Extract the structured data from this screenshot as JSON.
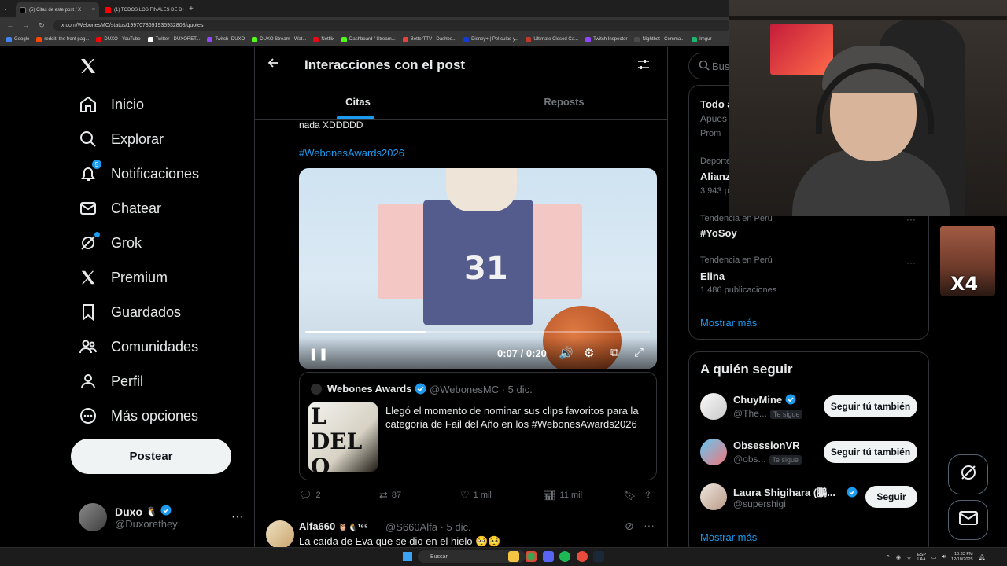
{
  "browser": {
    "tabs": [
      {
        "title": "(5) Citas de este post / X",
        "active": true,
        "color": "#ffffff"
      },
      {
        "title": "(1) TODOS LOS FINALES DE DI",
        "active": false,
        "color": "#ff0000"
      }
    ],
    "url": "x.com/WebonesMC/status/1997078691935932808/quotes",
    "bookmarks": [
      {
        "label": "Google",
        "color": "#4285f4"
      },
      {
        "label": "reddit: the front pag...",
        "color": "#ff4500"
      },
      {
        "label": "DUXO - YouTube",
        "color": "#ff0000"
      },
      {
        "label": "Twitter - DUXORET...",
        "color": "#ffffff"
      },
      {
        "label": "Twitch- DUXO",
        "color": "#9146ff"
      },
      {
        "label": "DUXO Stream - Wat...",
        "color": "#53fc18"
      },
      {
        "label": "Netflix",
        "color": "#e50914"
      },
      {
        "label": "Dashboard / Stream...",
        "color": "#53fc18"
      },
      {
        "label": "BetterTTV - Dashbo...",
        "color": "#e54141"
      },
      {
        "label": "Disney+ | Películas y...",
        "color": "#113ccf"
      },
      {
        "label": "Ultimate Closed Ca...",
        "color": "#c0392b"
      },
      {
        "label": "Twitch Inspector",
        "color": "#9146ff"
      },
      {
        "label": "Nightbot - Comma...",
        "color": "#4c4c4c"
      },
      {
        "label": "Imgur",
        "color": "#1bb76e"
      }
    ]
  },
  "nav": {
    "items": [
      {
        "label": "Inicio",
        "icon": "home-icon"
      },
      {
        "label": "Explorar",
        "icon": "search-icon"
      },
      {
        "label": "Notificaciones",
        "icon": "bell-icon",
        "badge": "5"
      },
      {
        "label": "Chatear",
        "icon": "mail-icon"
      },
      {
        "label": "Grok",
        "icon": "grok-icon"
      },
      {
        "label": "Premium",
        "icon": "x-icon"
      },
      {
        "label": "Guardados",
        "icon": "bookmark-icon"
      },
      {
        "label": "Comunidades",
        "icon": "people-icon"
      },
      {
        "label": "Perfil",
        "icon": "person-icon"
      },
      {
        "label": "Más opciones",
        "icon": "more-circle-icon"
      }
    ],
    "post_button": "Postear",
    "account": {
      "name": "Duxo",
      "handle": "@Duxorethey",
      "more": "···"
    }
  },
  "main": {
    "title": "Interacciones con el post",
    "tabs": [
      {
        "label": "Citas"
      },
      {
        "label": "Reposts"
      }
    ],
    "post": {
      "text": "nada XDDDDD",
      "hashtag": "#WebonesAwards2026",
      "video": {
        "number": "31",
        "time": "0:07 / 0:20",
        "progress": 0.35
      },
      "quote": {
        "name": "Webones Awards",
        "handle": "@WebonesMC · 5 dic.",
        "thumb_text": "L DEL O",
        "text": "Llegó el momento de nominar sus clips favoritos para la categoría de Fail del Año en los #WebonesAwards2026"
      },
      "stats": {
        "replies": "2",
        "reposts": "87",
        "likes": "1 mil",
        "views": "11 mil"
      }
    },
    "reply": {
      "name": "Alfa660",
      "name_extra": "🦉🐧¹⁹⁵",
      "handle": "@S660Alfa · 5 dic.",
      "text": "La caída de Eva que se dio en el hielo 🥺🥺"
    }
  },
  "sidebar": {
    "search_placeholder": "Busc",
    "trend_top": {
      "title": "Todo a",
      "line": "Apues",
      "promo": "Prom"
    },
    "trends": [
      {
        "context": "Deportes",
        "name": "Alianz",
        "count": "3.943 p"
      },
      {
        "context": "Tendencia en Perú",
        "name": "#YoSoy",
        "count": ""
      },
      {
        "context": "Tendencia en Perú",
        "name": "Elina",
        "count": "1.486 publicaciones"
      }
    ],
    "trends_more": "Mostrar más",
    "who_to_follow": {
      "title": "A quién seguir",
      "users": [
        {
          "name": "ChuyMine",
          "handle": "@The...",
          "follows_you": "Te sigue",
          "button": "Seguir tú también",
          "verified": true
        },
        {
          "name": "ObsessionVR",
          "handle": "@obs...",
          "follows_you": "Te sigue",
          "button": "Seguir tú también",
          "verified": false
        },
        {
          "name": "Laura Shigihara (鵬...",
          "handle": "@supershigi",
          "follows_you": "",
          "button": "Seguir",
          "verified": true
        }
      ],
      "more": "Mostrar más"
    }
  },
  "overlay": {
    "emote_text": "X4"
  },
  "taskbar": {
    "search_placeholder": "Buscar",
    "lang": [
      "ESP",
      "LAA"
    ],
    "time": "10:33 PM",
    "date": "12/10/2025"
  }
}
